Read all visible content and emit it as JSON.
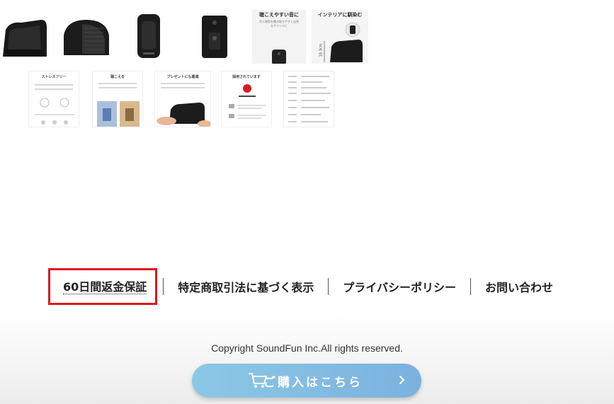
{
  "gallery": {
    "row1": {
      "hearing_caption": "聴こえやすい音に",
      "hearing_text": "声と物音を聞き取りやすく自然なサウンドに",
      "interior_caption": "インテリアに馴染む",
      "size_label": "10.3cm"
    },
    "row2": {
      "stress_free": "ストレスフリー",
      "audible": "聴こえる",
      "gift": "プレゼントにも最適",
      "adopted": "採用されています"
    }
  },
  "footer_nav": {
    "items": [
      "60日間返金保証",
      "特定商取引法に基づく表示",
      "プライバシーポリシー",
      "お問い合わせ"
    ]
  },
  "copyright": "Copyright SoundFun Inc.All rights reserved.",
  "purchase_button": {
    "label": "ご購入はこちら",
    "icon": "cart-icon",
    "arrow_icon": "chevron-right-icon",
    "gradient_start": "#8cc8e6",
    "gradient_end": "#7ab2de"
  },
  "highlight_color": "#e0161b"
}
